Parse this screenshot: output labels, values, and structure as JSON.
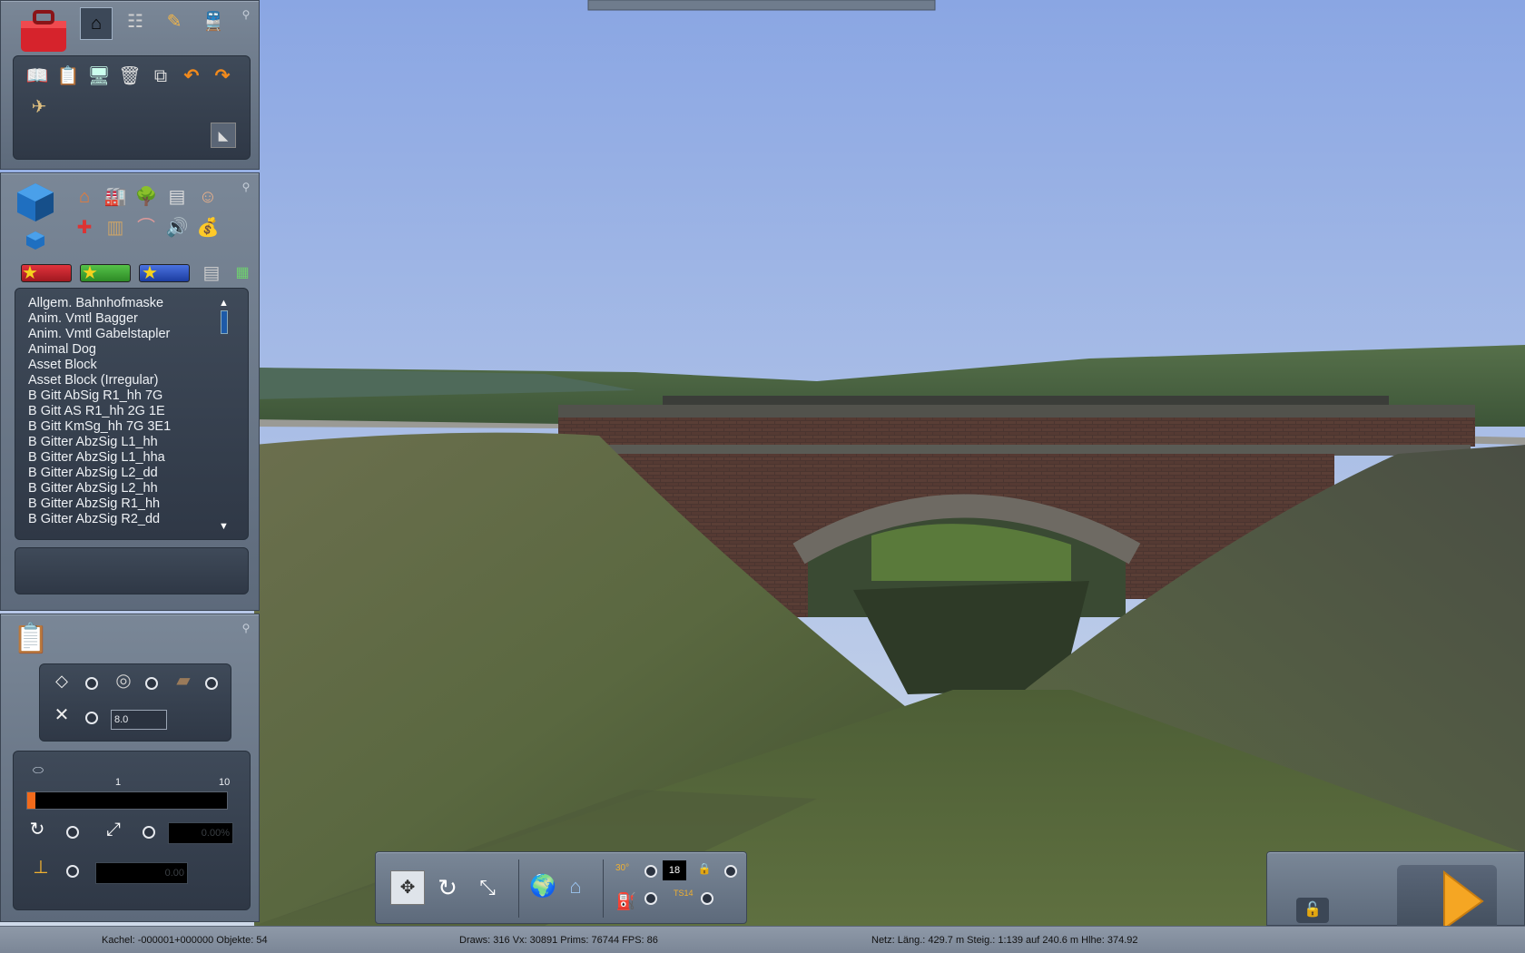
{
  "top_bar": {},
  "toolbox": {
    "tabs": [
      {
        "icon": "toolbox-icon"
      },
      {
        "icon": "house-icon"
      },
      {
        "icon": "track-icon"
      },
      {
        "icon": "paint-brush-icon"
      },
      {
        "icon": "locomotive-icon"
      }
    ],
    "tools": [
      {
        "icon": "open-book-icon"
      },
      {
        "icon": "clipboard-icon"
      },
      {
        "icon": "monitor-icon"
      },
      {
        "icon": "trash-icon"
      },
      {
        "icon": "copy-icon"
      },
      {
        "icon": "undo-icon"
      },
      {
        "icon": "redo-icon"
      },
      {
        "icon": "scenario-icon"
      }
    ]
  },
  "objects_panel": {
    "categories": [
      {
        "icon": "building-icon"
      },
      {
        "icon": "industry-icon"
      },
      {
        "icon": "tree-icon"
      },
      {
        "icon": "texture-icon"
      },
      {
        "icon": "person-icon"
      },
      {
        "icon": "signal-icon"
      },
      {
        "icon": "track-object-icon"
      },
      {
        "icon": "bridge-icon"
      },
      {
        "icon": "sound-icon"
      },
      {
        "icon": "bag-icon"
      }
    ],
    "filter_colors": [
      "#c8202a",
      "#3fa535",
      "#2b54c2"
    ],
    "asset_list": [
      "Allgem. Bahnhofmaske",
      "Anim. Vmtl Bagger",
      "Anim. Vmtl Gabelstapler",
      "Animal Dog",
      "Asset Block",
      "Asset Block (Irregular)",
      "B Gitt AbSig R1_hh 7G",
      "B Gitt AS R1_hh 2G 1E",
      "B Gitt KmSg_hh 7G 3E1",
      "B Gitter AbzSig L1_hh",
      "B Gitter AbzSig L1_hha",
      "B Gitter AbzSig L2_dd",
      "B Gitter AbzSig L2_hh",
      "B Gitter AbzSig R1_hh",
      "B Gitter AbzSig R2_dd"
    ]
  },
  "terrain_panel": {
    "value_field": "8.0",
    "slider_min": "1",
    "slider_max": "10",
    "slider_level": 0.04,
    "percent_field": "0.00%",
    "height_field": "0.00"
  },
  "camera_toolbar": {
    "grid_value": "18",
    "label_30": "30°",
    "label_ts14": "TS14"
  },
  "status_bar": {
    "tile": "Kachel: -000001+000000  Objekte: 54",
    "stats": "Draws: 316 Vx: 30891 Prims: 76744 FPS: 86",
    "net": "Netz:  Läng.:  429.7 m Steig.: 1:139 auf 240.6 m Hlhe: 374.92"
  },
  "colors": {
    "panel": "#6b7888",
    "sky_top": "#8aa6e3",
    "sky_bottom": "#c9d6ea",
    "grass": "#5b6b3c",
    "play_orange": "#f5a623"
  }
}
